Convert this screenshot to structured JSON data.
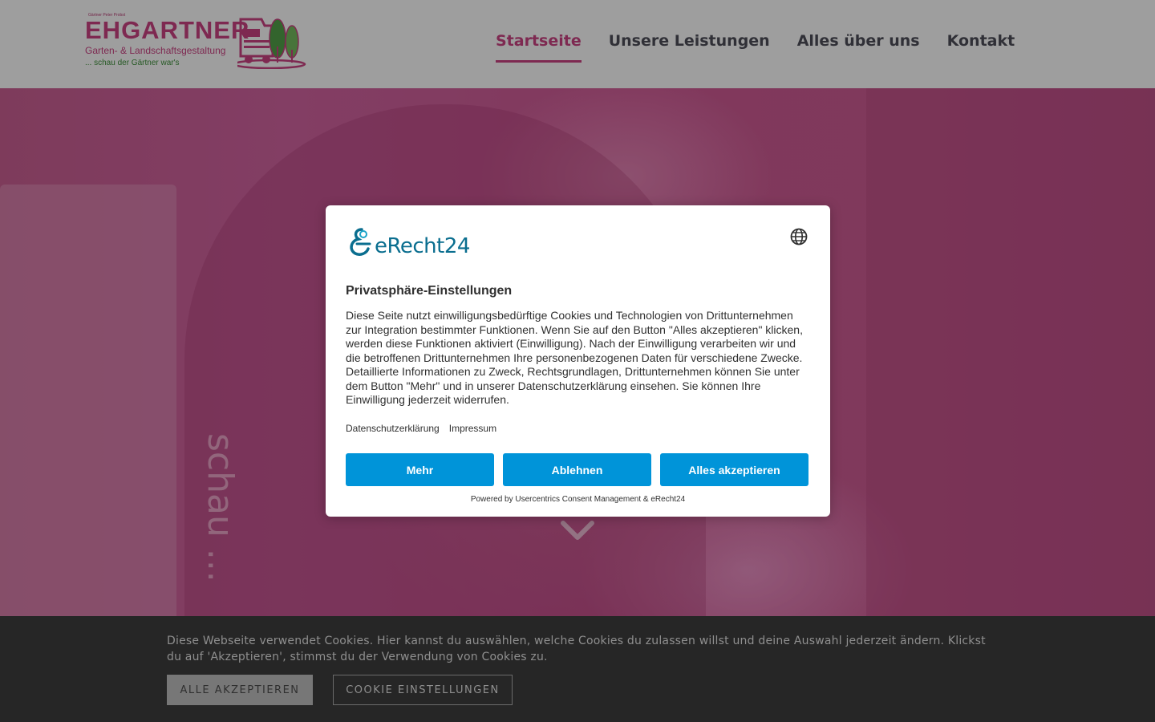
{
  "header": {
    "logo": {
      "small_text": "Gärtner Peter Probst",
      "name": "EHGARTNER",
      "subtitle": "Garten- & Landschaftsgestaltung",
      "tagline": "... schau der Gärtner war's"
    },
    "nav": [
      {
        "label": "Startseite",
        "active": true
      },
      {
        "label": "Unsere Leistungen",
        "active": false
      },
      {
        "label": "Alles über uns",
        "active": false
      },
      {
        "label": "Kontakt",
        "active": false
      }
    ]
  },
  "hero": {
    "shirt_text": "schau ..."
  },
  "consent_dialog": {
    "brand": "eRecht24",
    "language_icon": "globe-icon",
    "title": "Privatsphäre-Einstellungen",
    "body": "Diese Seite nutzt einwilligungsbedürftige Cookies und Technologien von Drittunternehmen zur Integration bestimmter Funktionen. Wenn Sie auf den Button \"Alles akzeptieren\" klicken, werden diese Funktionen aktiviert (Einwilligung). Nach der Einwilligung verarbeiten wir und die betroffenen Drittunternehmen Ihre personenbezogenen Daten für verschiedene Zwecke. Detaillierte Informationen zu Zweck, Rechtsgrundlagen, Drittunternehmen können Sie unter dem Button \"Mehr\" und in unserer Datenschutzerklärung einsehen. Sie können Ihre Einwilligung jederzeit widerrufen.",
    "links": {
      "privacy": "Datenschutzerklärung",
      "imprint": "Impressum"
    },
    "buttons": {
      "more": "Mehr",
      "reject": "Ablehnen",
      "accept_all": "Alles akzeptieren"
    },
    "powered_by": "Powered by Usercentrics Consent Management & eRecht24"
  },
  "cookie_bar": {
    "text": "Diese Webseite verwendet Cookies. Hier kannst du auswählen, welche Cookies du zulassen willst und deine Auswahl jederzeit ändern. Klickst du auf 'Akzeptieren', stimmst du der Verwendung von Cookies zu.",
    "accept_all": "ALLE AKZEPTIEREN",
    "settings": "COOKIE EINSTELLUNGEN"
  },
  "colors": {
    "brand_pink": "#c2407d",
    "brand_green": "#3d8a3a",
    "consent_blue": "#0094d9",
    "erecht_teal": "#0a6e8f",
    "cookie_bar_bg": "#262626"
  }
}
